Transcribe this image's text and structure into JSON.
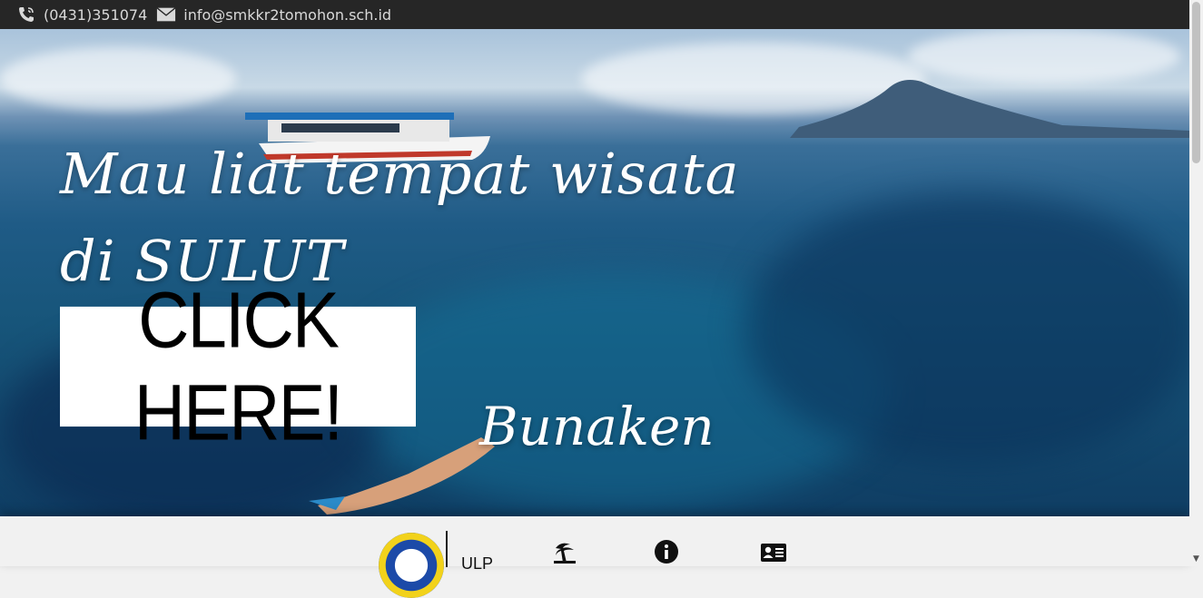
{
  "topbar": {
    "phone": "(0431)351074",
    "email": "info@smkkr2tomohon.sch.id"
  },
  "hero": {
    "headline": "Mau liat tempat wisata di SULUT",
    "cta_label": "CLICK HERE!",
    "place_name": "Bunaken"
  },
  "nav": {
    "brand": "ULP",
    "icons": [
      "beach-icon",
      "info-icon",
      "contact-card-icon"
    ]
  },
  "colors": {
    "topbar_bg": "#262626",
    "cta_bg": "#ffffff",
    "nav_bg": "#f1f1f1"
  }
}
